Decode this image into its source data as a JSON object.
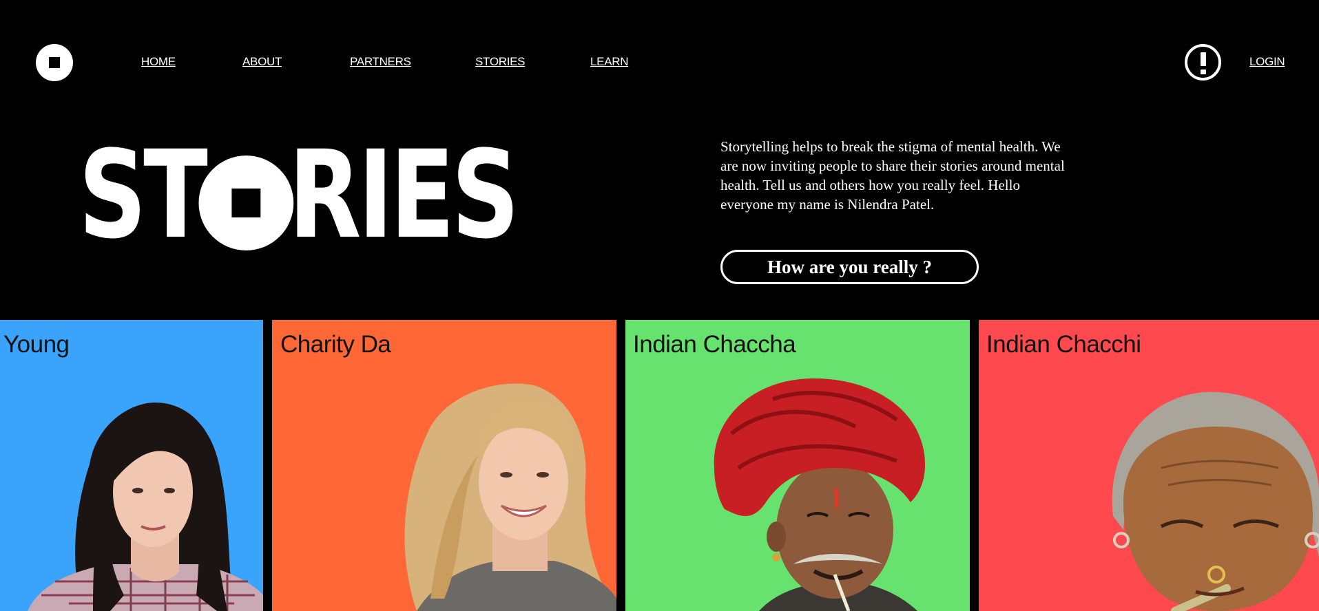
{
  "nav": {
    "items": [
      {
        "label": "HOME"
      },
      {
        "label": "ABOUT"
      },
      {
        "label": "PARTNERS"
      },
      {
        "label": "STORIES"
      },
      {
        "label": "LEARN"
      }
    ],
    "login_label": "LOGIN"
  },
  "hero": {
    "title_prefix": "ST",
    "title_suffix": "RIES",
    "description": "Storytelling helps to break the stigma of mental health. We are now inviting people to share their stories around mental health. Tell us and others how you really feel. Hello everyone my name is Nilendra Patel.",
    "cta_label": "How are you really ?"
  },
  "stories": [
    {
      "name": "Young",
      "color": "#3aa3fb"
    },
    {
      "name": "Charity Da",
      "color": "#ff6836"
    },
    {
      "name": "Indian Chaccha",
      "color": "#68e26e"
    },
    {
      "name": "Indian Chacchi",
      "color": "#fe4a4f"
    }
  ],
  "colors": {
    "background": "#000000",
    "text": "#ffffff"
  }
}
